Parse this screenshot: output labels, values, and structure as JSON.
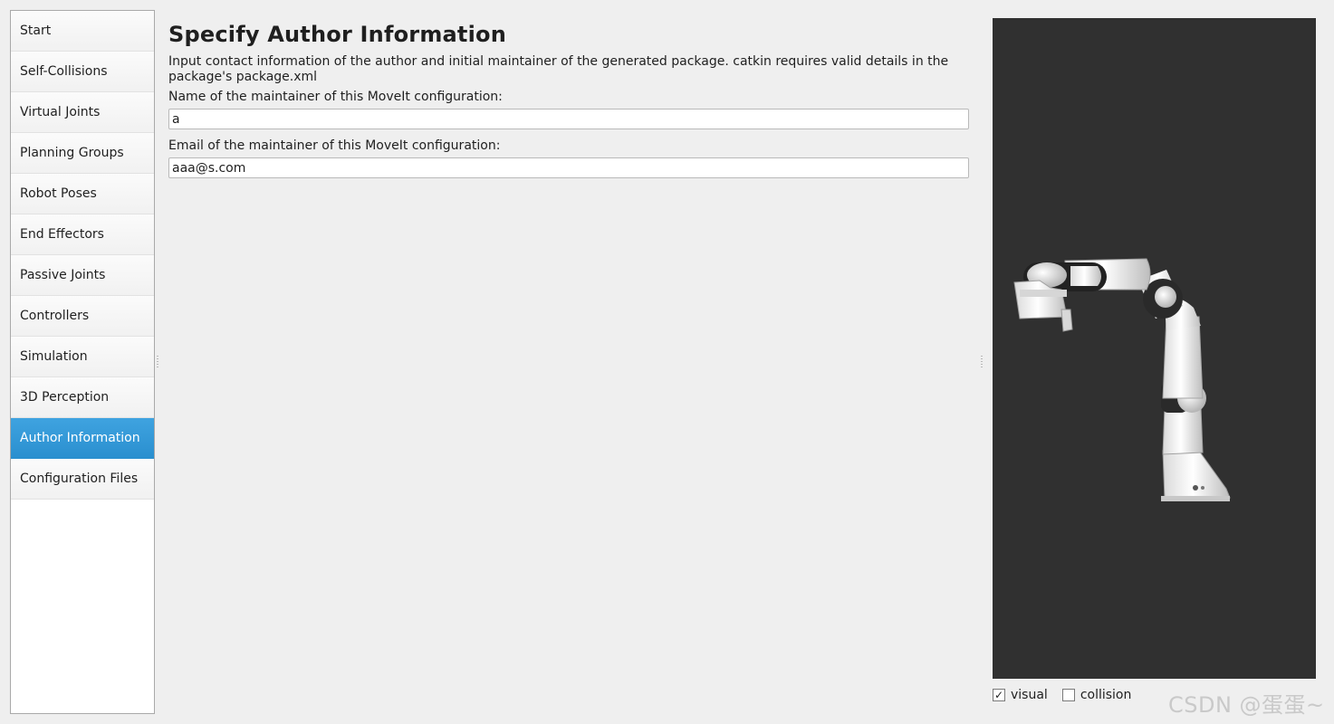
{
  "sidebar": {
    "items": [
      {
        "label": "Start"
      },
      {
        "label": "Self-Collisions"
      },
      {
        "label": "Virtual Joints"
      },
      {
        "label": "Planning Groups"
      },
      {
        "label": "Robot Poses"
      },
      {
        "label": "End Effectors"
      },
      {
        "label": "Passive Joints"
      },
      {
        "label": "Controllers"
      },
      {
        "label": "Simulation"
      },
      {
        "label": "3D Perception"
      },
      {
        "label": "Author Information"
      },
      {
        "label": "Configuration Files"
      }
    ],
    "selected_index": 10
  },
  "main": {
    "title": "Specify Author Information",
    "description": "Input contact information of the author and initial maintainer of the generated package. catkin requires valid details in the package's package.xml",
    "name_label": "Name of the maintainer of this MoveIt configuration:",
    "name_value": "a",
    "email_label": "Email of the maintainer of this MoveIt configuration:",
    "email_value": "aaa@s.com"
  },
  "viewer": {
    "visual_label": "visual",
    "visual_checked": true,
    "collision_label": "collision",
    "collision_checked": false,
    "background_color": "#303030"
  },
  "watermark": "CSDN @蛋蛋~"
}
